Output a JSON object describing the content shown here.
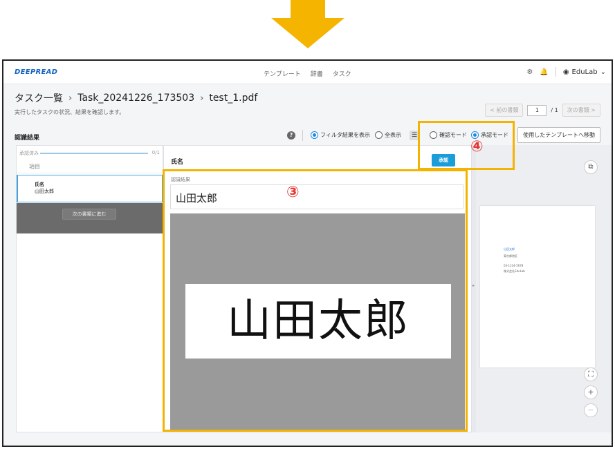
{
  "app": {
    "logo": "DEEPREAD"
  },
  "nav": [
    "テンプレート",
    "辞書",
    "タスク"
  ],
  "user": {
    "name": "EduLab"
  },
  "breadcrumb": {
    "root": "タスク一覧",
    "task": "Task_20241226_173503",
    "file": "test_1.pdf",
    "sep": "›"
  },
  "subtitle": "実行したタスクの状況、結果を確認します。",
  "pager": {
    "prev": "< 前の書類",
    "current": "1",
    "total": "/ 1",
    "next": "次の書類 >"
  },
  "section": {
    "title": "認識結果"
  },
  "filters": {
    "filtered": "フィルタ結果を表示",
    "all": "全表示",
    "selected": "filtered"
  },
  "modes": {
    "confirm": "確認モード",
    "approve": "承認モード",
    "selected": "approve"
  },
  "template_button": "使用したテンプレートへ移動",
  "progress": {
    "label": "承認済み",
    "count": "0/1",
    "fraction": 0
  },
  "items_header": "項目",
  "item": {
    "field": "氏名",
    "value": "山田太郎"
  },
  "next_doc_button": "次の書類に進む",
  "detail": {
    "field_name": "氏名",
    "approve_button": "承認",
    "recognition_label": "認識結果",
    "recognized_value": "山田太郎",
    "image_text": "山田太郎"
  },
  "document_preview": {
    "lines": [
      "山田太郎",
      "東京都港区",
      "03-1234-5678",
      "株式会社EduLab"
    ]
  },
  "annotations": {
    "three": "③",
    "four": "④"
  },
  "colors": {
    "accent": "#1a9dd9",
    "highlight": "#f3b300",
    "badge": "#e53935",
    "logo": "#1565c0"
  }
}
